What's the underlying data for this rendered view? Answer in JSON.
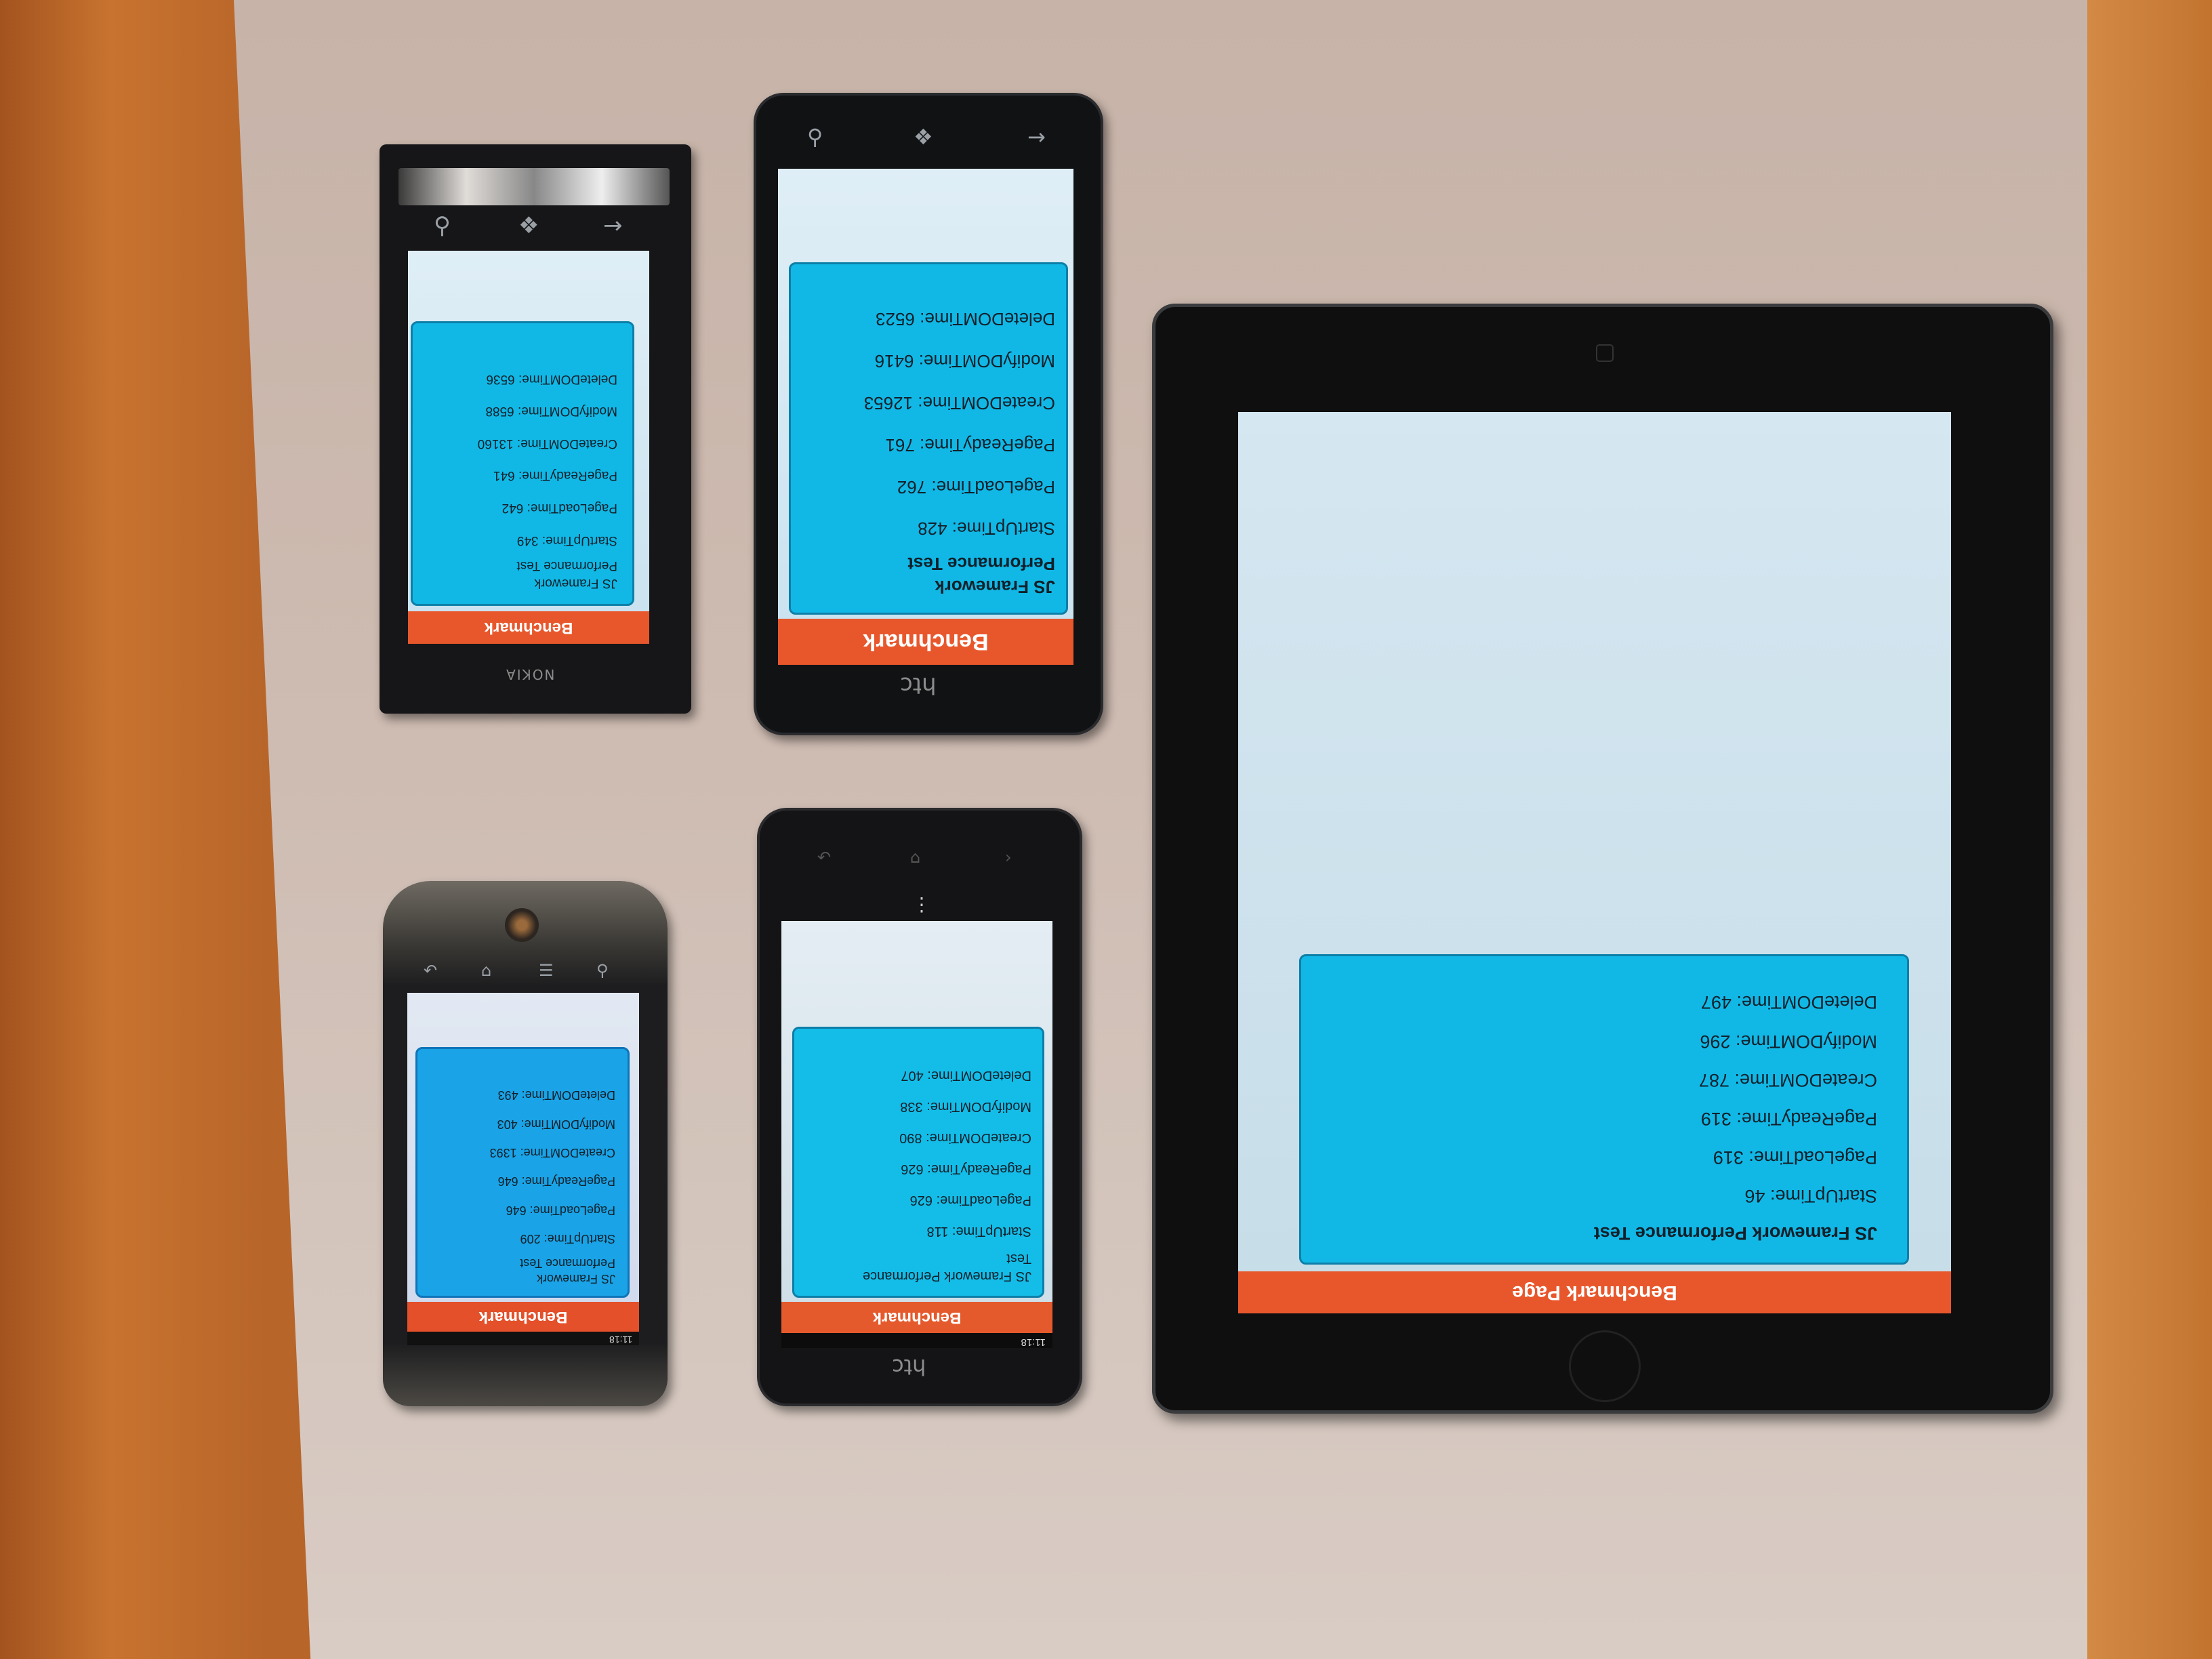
{
  "devices": {
    "nokia": {
      "brand": "NOKIA",
      "header": "Benchmark",
      "title_lines": [
        "JS Framework",
        "Performance Test"
      ],
      "metrics": [
        "StartUpTime: 349",
        "PageLoadTime: 642",
        "PageReadyTime: 641",
        "CreateDOMTime: 13160",
        "ModifyDOMTime: 6588",
        "DeleteDOMTime: 6536"
      ]
    },
    "htc_titan": {
      "brand": "htc",
      "header": "Benchmark",
      "title_lines": [
        "JS Framework",
        "Performance Test"
      ],
      "metrics": [
        "StartUpTime: 428",
        "PageLoadTime: 762",
        "PageReadyTime: 761",
        "CreateDOMTime: 12653",
        "ModifyDOMTime: 6416",
        "DeleteDOMTime: 6523"
      ]
    },
    "htc_desire": {
      "header": "Benchmark",
      "status_time": "11:18",
      "title_lines": [
        "JS Framework",
        "Performance Test"
      ],
      "metrics": [
        "StartUpTime: 209",
        "PageLoadTime: 646",
        "PageReadyTime: 646",
        "CreateDOMTime: 1393",
        "ModifyDOMTime: 403",
        "DeleteDOMTime: 493"
      ]
    },
    "htc_one": {
      "brand": "htc",
      "header": "Benchmark",
      "status_time": "11:18",
      "title_lines": [
        "JS Framework Performance",
        "Test"
      ],
      "metrics": [
        "StartUpTime: 118",
        "PageLoadTime: 626",
        "PageReadyTime: 626",
        "CreateDOMTime: 890",
        "ModifyDOMTime: 338",
        "DeleteDOMTime: 407"
      ]
    },
    "ipad": {
      "header": "Benchmark Page",
      "title_lines": [
        "JS Framework Performance Test"
      ],
      "metrics": [
        "StartUpTime: 46",
        "PageLoadTime: 319",
        "PageReadyTime: 319",
        "CreateDOMTime: 787",
        "ModifyDOMTime: 296",
        "DeleteDOMTime: 497"
      ]
    }
  }
}
